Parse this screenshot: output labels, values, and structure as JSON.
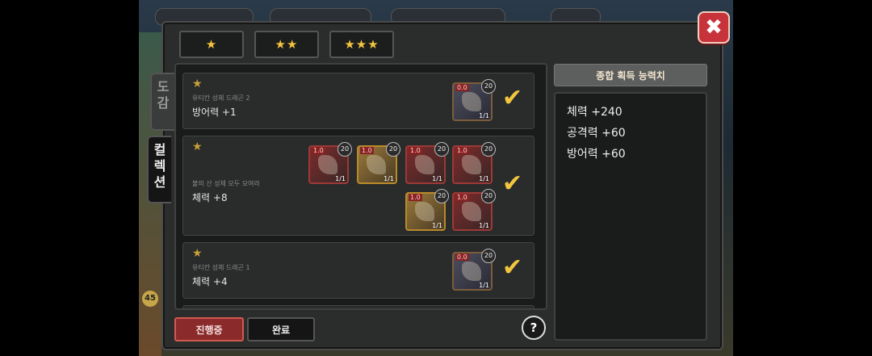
{
  "star_tabs": [
    "★",
    "★★",
    "★★★"
  ],
  "side_tabs": [
    {
      "label": "도감"
    },
    {
      "label": "컬렉션"
    }
  ],
  "cards": [
    {
      "star": "★",
      "subtitle": "유티칸 성체 드래곤 2",
      "stat": "방어력 +1",
      "dragons": [
        {
          "level": "0.0",
          "badge": "20",
          "count": "1/1",
          "tone": "blue"
        }
      ]
    },
    {
      "star": "★",
      "subtitle": "불의 산 성체 모두 모여라",
      "stat": "체력 +8",
      "dragons": [
        {
          "level": "1.0",
          "badge": "20",
          "count": "1/1",
          "tone": "red"
        },
        {
          "level": "1.0",
          "badge": "20",
          "count": "1/1",
          "tone": "gold"
        },
        {
          "level": "1.0",
          "badge": "20",
          "count": "1/1",
          "tone": "red"
        },
        {
          "level": "1.0",
          "badge": "20",
          "count": "1/1",
          "tone": "red"
        },
        {
          "level": "1.0",
          "badge": "20",
          "count": "1/1",
          "tone": "gold"
        },
        {
          "level": "1.0",
          "badge": "20",
          "count": "1/1",
          "tone": "red"
        }
      ]
    },
    {
      "star": "★",
      "subtitle": "유티칸 성체 드래곤 1",
      "stat": "체력 +4",
      "dragons": [
        {
          "level": "0.0",
          "badge": "20",
          "count": "1/1",
          "tone": "blue"
        }
      ]
    }
  ],
  "buttons": {
    "in_progress": "진행중",
    "complete": "완료",
    "help": "?",
    "close": "✖"
  },
  "summary": {
    "header": "종합 획득 능력치",
    "lines": [
      "체력 +240",
      "공격력 +60",
      "방어력 +60"
    ]
  },
  "check_icon": "✔",
  "background": {
    "badge": "45"
  }
}
